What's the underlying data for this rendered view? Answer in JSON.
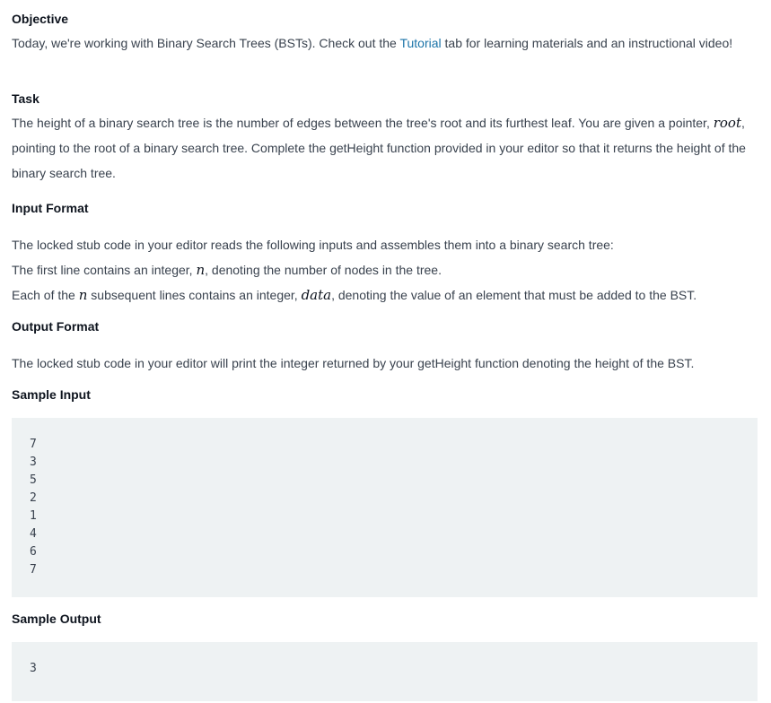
{
  "objective": {
    "heading": "Objective",
    "text_before_link": "Today, we're working with Binary Search Trees (BSTs). Check out the ",
    "link": "Tutorial",
    "text_after_link": " tab for learning materials and an instructional video!"
  },
  "task": {
    "heading": "Task",
    "text_1": "The height of a binary search tree is the number of edges between the tree's root and its furthest leaf. You are given a pointer, ",
    "var_root": "root",
    "text_2": ", pointing to the root of a binary search tree. Complete the getHeight function provided in your editor so that it returns the height of the binary search tree."
  },
  "input_format": {
    "heading": "Input Format",
    "line_1": "The locked stub code in your editor reads the following inputs and assembles them into a binary search tree:",
    "line_2_before": "The first line contains an integer, ",
    "var_n": "n",
    "line_2_after": ", denoting the number of nodes in the tree.",
    "line_3_before": "Each of the ",
    "line_3_mid": " subsequent lines contains an integer, ",
    "var_data": "data",
    "line_3_after": ", denoting the value of an element that must be added to the BST."
  },
  "output_format": {
    "heading": "Output Format",
    "text": "The locked stub code in your editor will print the integer returned by your getHeight function denoting the height of the BST."
  },
  "sample_input": {
    "heading": "Sample Input",
    "lines": [
      "7",
      "3",
      "5",
      "2",
      "1",
      "4",
      "6",
      "7"
    ]
  },
  "sample_output": {
    "heading": "Sample Output",
    "lines": [
      "3"
    ]
  }
}
